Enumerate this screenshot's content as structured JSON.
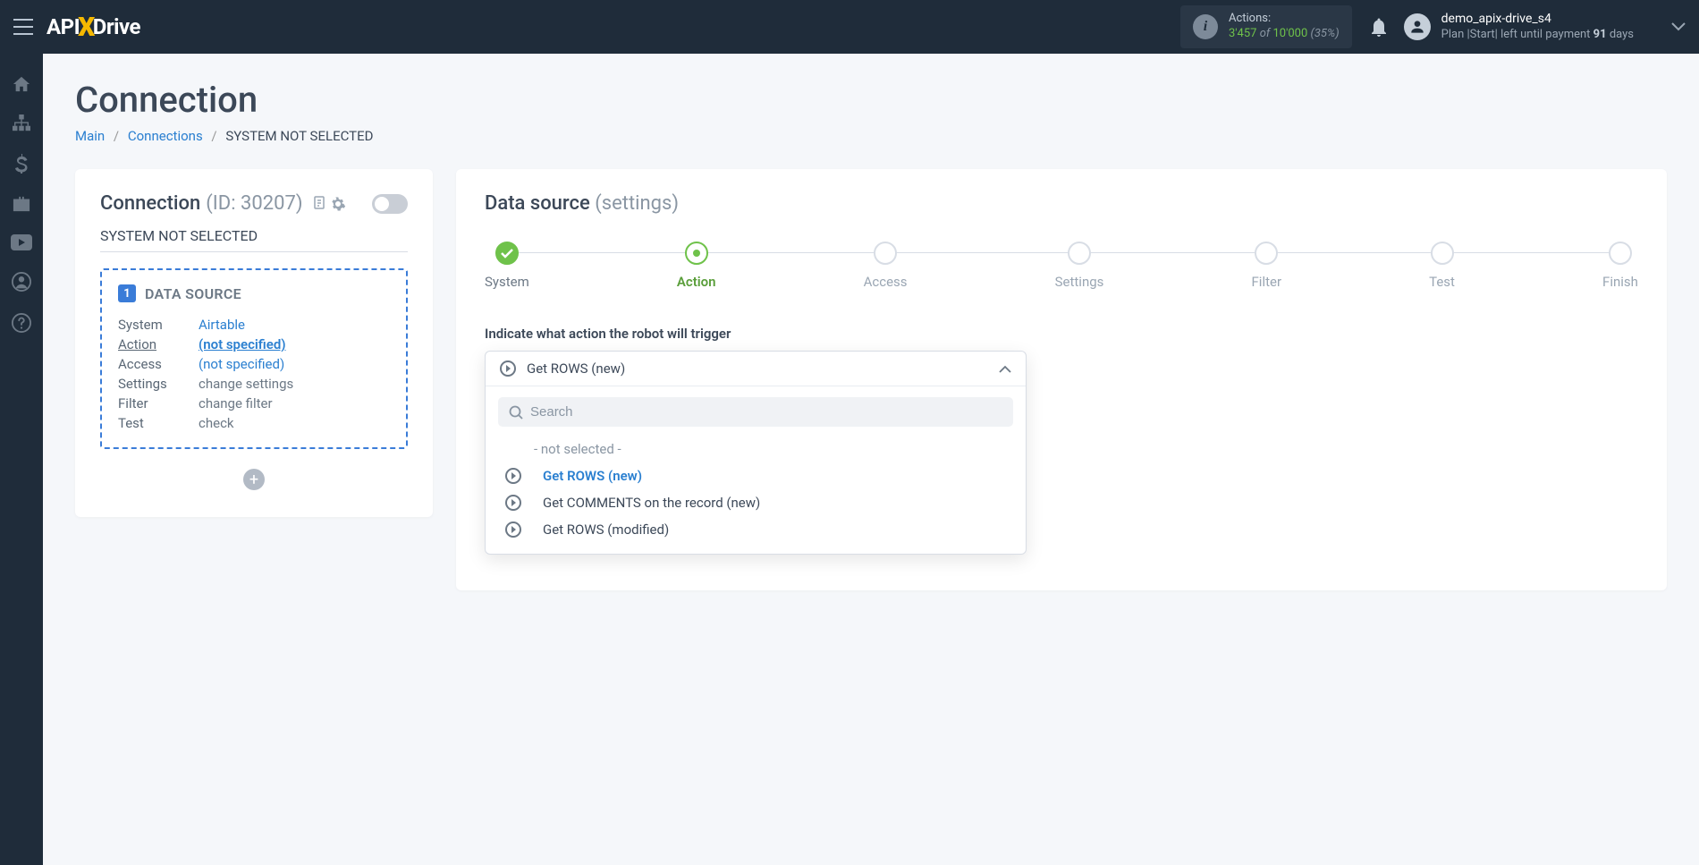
{
  "topbar": {
    "actions_label": "Actions:",
    "actions_count": "3'457",
    "actions_of": "of",
    "actions_total": "10'000",
    "actions_percent": "(35%)",
    "username": "demo_apix-drive_s4",
    "plan_prefix": "Plan |Start| left until payment ",
    "plan_days": "91",
    "plan_suffix": " days"
  },
  "page": {
    "title": "Connection",
    "breadcrumb": {
      "main": "Main",
      "connections": "Connections",
      "current": "SYSTEM NOT SELECTED"
    }
  },
  "left": {
    "conn_label": "Connection",
    "conn_id": "(ID: 30207)",
    "not_selected": "SYSTEM NOT SELECTED",
    "ds_num": "1",
    "ds_title": "DATA SOURCE",
    "rows": {
      "system_label": "System",
      "system_value": "Airtable",
      "action_label": "Action",
      "action_value": "(not specified)",
      "access_label": "Access",
      "access_value": "(not specified)",
      "settings_label": "Settings",
      "settings_value": "change settings",
      "filter_label": "Filter",
      "filter_value": "change filter",
      "test_label": "Test",
      "test_value": "check"
    }
  },
  "right": {
    "title": "Data source",
    "subtitle": "(settings)",
    "steps": [
      "System",
      "Action",
      "Access",
      "Settings",
      "Filter",
      "Test",
      "Finish"
    ],
    "field_label": "Indicate what action the robot will trigger",
    "dropdown": {
      "selected": "Get ROWS (new)",
      "search_placeholder": "Search",
      "none_option": "- not selected -",
      "options": [
        "Get ROWS (new)",
        "Get COMMENTS on the record (new)",
        "Get ROWS (modified)"
      ]
    }
  }
}
